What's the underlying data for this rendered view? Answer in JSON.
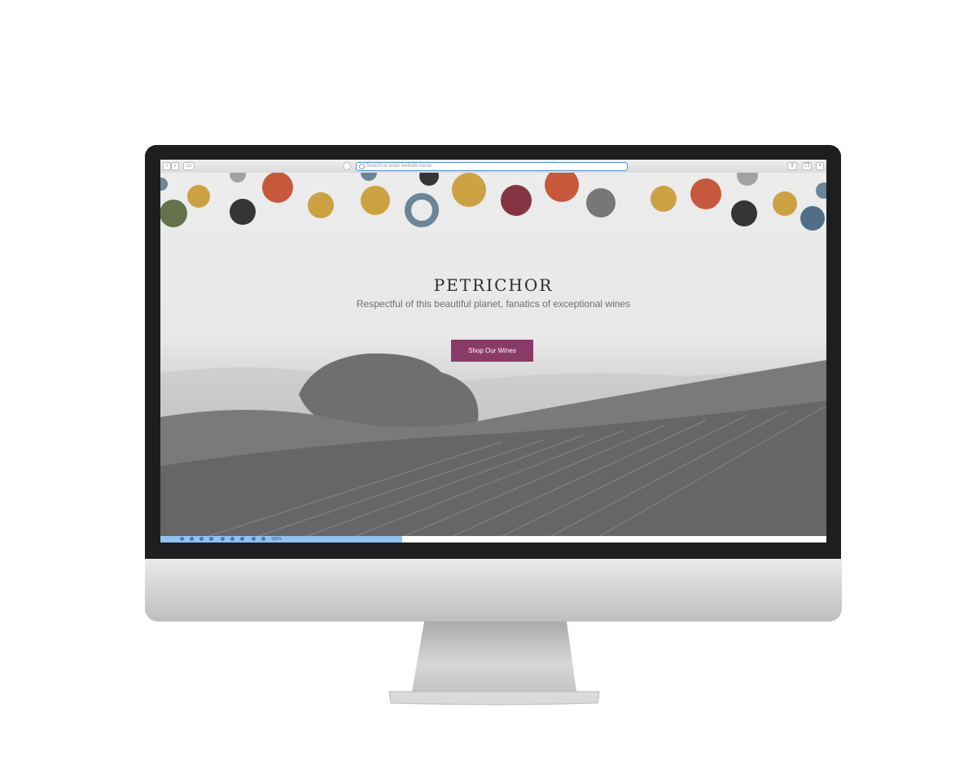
{
  "browser": {
    "address_placeholder": "Search or enter website name",
    "back_icon": "chevron-left-icon",
    "forward_icon": "chevron-right-icon",
    "sidebar_icon": "sidebar-icon",
    "share_icon": "share-icon",
    "tabs_icon": "tabs-icon",
    "new_tab_label": "+"
  },
  "site": {
    "logo": "PETRICHOR",
    "tagline": "Respectful of this beautiful planet, fanatics of exceptional wines",
    "cta_label": "Shop Our Wines",
    "accent_color": "#8a3a67"
  },
  "statusbar": {
    "zoom_text": "100%"
  },
  "dots_palette": [
    "#c24a2a",
    "#c99a30",
    "#222222",
    "#5f7a8f",
    "#7b2030",
    "#6b6b6b",
    "#56663a",
    "#9a9a9a",
    "#40617e"
  ]
}
